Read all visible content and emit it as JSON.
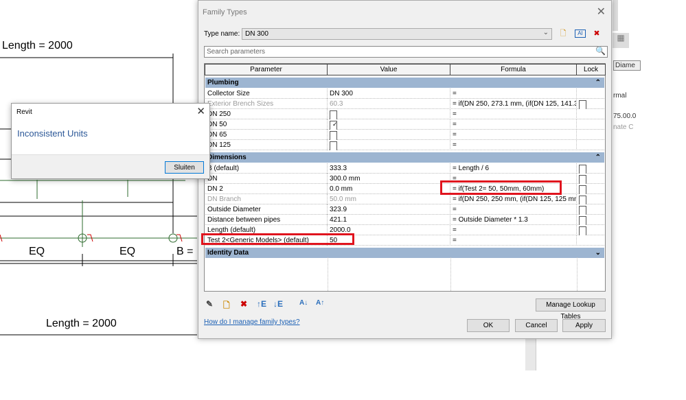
{
  "drawing": {
    "length_top": "Length = 2000",
    "length_bottom": "Length = 2000",
    "eq1": "EQ",
    "eq2": "EQ",
    "b_label": "B ="
  },
  "background_panel": {
    "items": [
      "Diame",
      "rmal",
      "75.00.0",
      "nate C"
    ]
  },
  "family_types": {
    "title": "Family Types",
    "type_name_label": "Type name:",
    "type_name_value": "DN 300",
    "search_placeholder": "Search parameters",
    "columns": [
      "Parameter",
      "Value",
      "Formula",
      "Lock"
    ],
    "groups": [
      {
        "name": "Plumbing",
        "toggle": "collapse",
        "rows": [
          {
            "parameter": "Collector Size",
            "value": "DN 300",
            "formula": "=",
            "lock": null,
            "gray": false
          },
          {
            "parameter": "Exterior Brench Sizes",
            "value": "60.3",
            "formula": "= if(DN 250, 273.1 mm, (if(DN 125, 141.3",
            "lock": false,
            "gray": true
          },
          {
            "parameter": "DN 250",
            "value_checkbox": false,
            "formula": "=",
            "lock": null
          },
          {
            "parameter": "DN 50",
            "value_checkbox": true,
            "formula": "=",
            "lock": null
          },
          {
            "parameter": "DN 65",
            "value_checkbox": false,
            "formula": "=",
            "lock": null
          },
          {
            "parameter": "DN 125",
            "value_checkbox": false,
            "formula": "=",
            "lock": null
          }
        ]
      },
      {
        "name": "Dimensions",
        "toggle": "collapse",
        "rows": [
          {
            "parameter": "B (default)",
            "value": "333.3",
            "formula": "= Length / 6",
            "lock": false,
            "gray": false
          },
          {
            "parameter": "DN",
            "value": "300.0 mm",
            "formula": "=",
            "lock": false,
            "gray": false
          },
          {
            "parameter": "DN 2",
            "value": "0.0 mm",
            "formula": "= if(Test 2= 50, 50mm, 60mm)",
            "lock": false,
            "gray": false,
            "highlight": "formula"
          },
          {
            "parameter": "DN Branch",
            "value": "50.0 mm",
            "formula": "= if(DN 250, 250 mm, (if(DN 125, 125 mm,",
            "lock": false,
            "gray": true
          },
          {
            "parameter": "Outside Diameter",
            "value": "323.9",
            "formula": "=",
            "lock": false,
            "gray": false
          },
          {
            "parameter": "Distance between pipes",
            "value": "421.1",
            "formula": "= Outside Diameter * 1.3",
            "lock": false,
            "gray": false
          },
          {
            "parameter": "Length (default)",
            "value": "2000.0",
            "formula": "=",
            "lock": false,
            "gray": false
          },
          {
            "parameter": "Test 2<Generic Models> (default)",
            "value": "50",
            "formula": "=",
            "lock": null,
            "gray": false,
            "highlight": "parameter"
          }
        ]
      },
      {
        "name": "Identity Data",
        "toggle": "expand",
        "rows": []
      }
    ],
    "manage_lookup": "Manage Lookup Tables",
    "help_link": "How do I manage family types?",
    "ok": "OK",
    "cancel": "Cancel",
    "apply": "Apply",
    "highlight_color": "#e0141e"
  },
  "revit_dialog": {
    "title": "Revit",
    "message": "Inconsistent Units",
    "button": "Sluiten"
  }
}
